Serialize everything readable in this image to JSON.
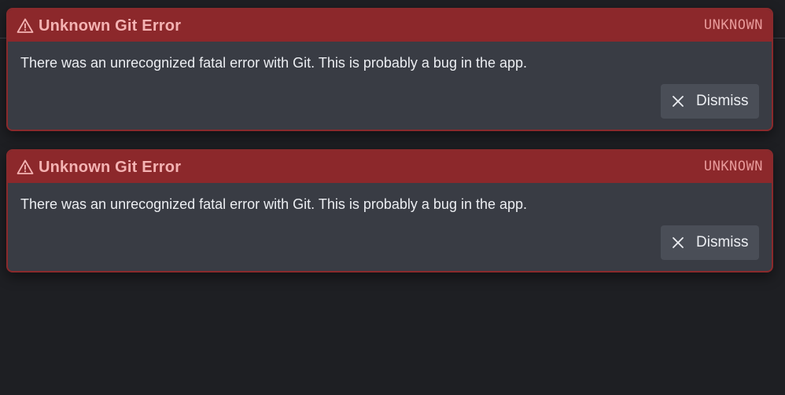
{
  "notifications": [
    {
      "title": "Unknown Git Error",
      "code": "UNKNOWN",
      "message": "There was an unrecognized fatal error with Git. This is probably a bug in the app.",
      "dismiss_label": "Dismiss",
      "icon": "warning-icon"
    },
    {
      "title": "Unknown Git Error",
      "code": "UNKNOWN",
      "message": "There was an unrecognized fatal error with Git. This is probably a bug in the app.",
      "dismiss_label": "Dismiss",
      "icon": "warning-icon"
    }
  ],
  "colors": {
    "background": "#1e1f23",
    "card_bg": "#393c44",
    "header_bg": "#8c282b",
    "title_text": "#f4b3b3",
    "code_text": "#e89a9a",
    "button_bg": "#4a4e57"
  }
}
